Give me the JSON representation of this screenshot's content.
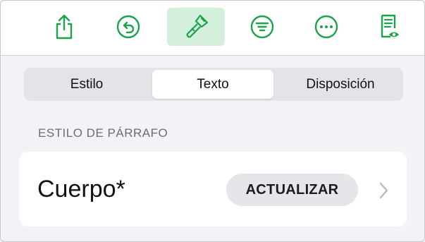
{
  "colors": {
    "accent": "#1aa34a",
    "active_tool_bg": "#d4efdc",
    "panel_bg": "#f2f2f7"
  },
  "toolbar": {
    "tools": [
      {
        "icon": "share-icon"
      },
      {
        "icon": "undo-icon"
      },
      {
        "icon": "format-brush-icon",
        "active": true
      },
      {
        "icon": "organize-icon"
      },
      {
        "icon": "more-icon"
      },
      {
        "icon": "document-view-icon"
      }
    ]
  },
  "tabs": {
    "items": [
      "Estilo",
      "Texto",
      "Disposición"
    ],
    "selected": "Texto"
  },
  "paragraph_style": {
    "section_label": "ESTILO DE PÁRRAFO",
    "current_style": "Cuerpo*",
    "update_label": "ACTUALIZAR"
  }
}
